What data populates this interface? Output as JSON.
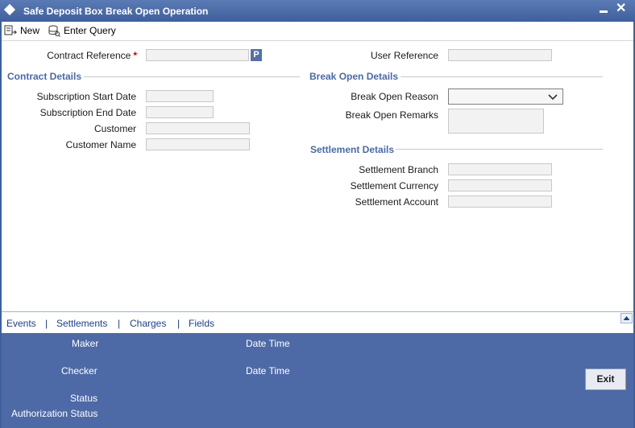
{
  "window": {
    "title": "Safe Deposit Box Break Open Operation"
  },
  "toolbar": {
    "new_label": "New",
    "enter_query_label": "Enter Query"
  },
  "header": {
    "contract_reference_label": "Contract Reference",
    "required_mark": "*",
    "lov_button_label": "P",
    "user_reference_label": "User Reference"
  },
  "contract_details": {
    "title": "Contract Details",
    "subscription_start_date_label": "Subscription Start Date",
    "subscription_end_date_label": "Subscription End Date",
    "customer_label": "Customer",
    "customer_name_label": "Customer Name"
  },
  "break_open_details": {
    "title": "Break Open Details",
    "reason_label": "Break Open Reason",
    "remarks_label": "Break Open Remarks"
  },
  "settlement_details": {
    "title": "Settlement Details",
    "branch_label": "Settlement Branch",
    "currency_label": "Settlement Currency",
    "account_label": "Settlement Account"
  },
  "tabs": [
    {
      "label": "Events"
    },
    {
      "label": "Settlements"
    },
    {
      "label": "Charges"
    },
    {
      "label": "Fields"
    }
  ],
  "tab_separator": "|",
  "footer": {
    "maker_label": "Maker",
    "checker_label": "Checker",
    "date_time_label": "Date Time",
    "status_label": "Status",
    "authorization_status_label": "Authorization Status",
    "exit_label": "Exit"
  },
  "colors": {
    "accent": "#4d6aa6",
    "section_title": "#4a6aa5",
    "link": "#1d3f8a"
  },
  "icons": [
    "diamond-icon",
    "minimize-icon",
    "close-icon",
    "new-icon",
    "enter-query-icon",
    "chevron-down-icon",
    "scroll-up-icon"
  ]
}
